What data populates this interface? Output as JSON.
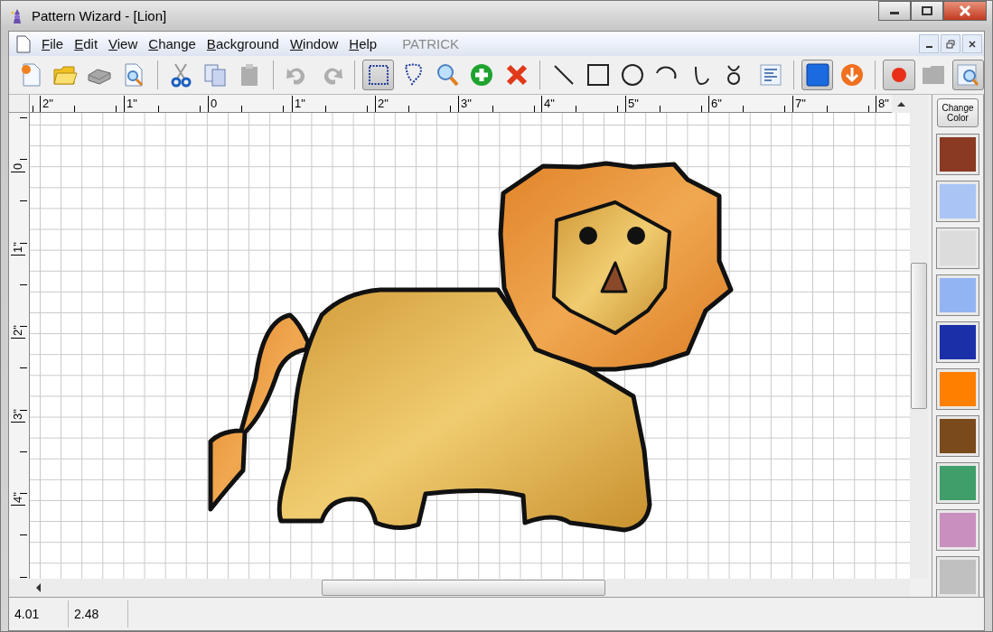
{
  "window": {
    "title": "Pattern Wizard - [Lion]"
  },
  "menu": {
    "items": [
      "File",
      "Edit",
      "View",
      "Change",
      "Background",
      "Window",
      "Help"
    ],
    "user": "PATRICK"
  },
  "toolbar": [
    [
      {
        "kind": "new",
        "pressed": false,
        "disabled": false
      },
      {
        "kind": "open",
        "pressed": false,
        "disabled": false
      },
      {
        "kind": "scanner",
        "pressed": false,
        "disabled": false
      },
      {
        "kind": "preview",
        "pressed": false,
        "disabled": false
      }
    ],
    [
      {
        "kind": "cut",
        "pressed": false,
        "disabled": false
      },
      {
        "kind": "copy",
        "pressed": false,
        "disabled": false
      },
      {
        "kind": "paste",
        "pressed": false,
        "disabled": true
      }
    ],
    [
      {
        "kind": "undo",
        "pressed": false,
        "disabled": true
      },
      {
        "kind": "redo",
        "pressed": false,
        "disabled": true
      }
    ],
    [
      {
        "kind": "select",
        "pressed": true,
        "disabled": false
      },
      {
        "kind": "lasso",
        "pressed": false,
        "disabled": false
      },
      {
        "kind": "zoom",
        "pressed": false,
        "disabled": false
      },
      {
        "kind": "add",
        "pressed": false,
        "disabled": false
      },
      {
        "kind": "delete",
        "pressed": false,
        "disabled": false
      }
    ],
    [
      {
        "kind": "line",
        "pressed": false,
        "disabled": false
      },
      {
        "kind": "rect",
        "pressed": false,
        "disabled": false
      },
      {
        "kind": "circle",
        "pressed": false,
        "disabled": false
      },
      {
        "kind": "arc",
        "pressed": false,
        "disabled": false
      },
      {
        "kind": "curve",
        "pressed": false,
        "disabled": false
      },
      {
        "kind": "loop",
        "pressed": false,
        "disabled": false
      },
      {
        "kind": "text",
        "pressed": false,
        "disabled": false
      }
    ],
    [
      {
        "kind": "fill",
        "pressed": true,
        "disabled": false
      },
      {
        "kind": "download",
        "pressed": false,
        "disabled": false
      }
    ],
    [
      {
        "kind": "record",
        "pressed": true,
        "disabled": false
      },
      {
        "kind": "panel",
        "pressed": false,
        "disabled": true
      },
      {
        "kind": "inspect",
        "pressed": true,
        "disabled": false
      }
    ]
  ],
  "ruler_h": [
    "2\"",
    "1\"",
    "0",
    "1\"",
    "2\"",
    "3\"",
    "4\"",
    "5\"",
    "6\"",
    "7\"",
    "8\""
  ],
  "ruler_v": [
    "0",
    "1\"",
    "2\"",
    "3\"",
    "4\""
  ],
  "palette": {
    "button": "Change Color",
    "swatches": [
      {
        "color": "#8a3a22"
      },
      {
        "color": "#a9c4f5"
      },
      {
        "color": "#dcdcdc"
      },
      {
        "color": "#93b4f2"
      },
      {
        "color": "#1a2fa8"
      },
      {
        "color": "#ff8000"
      },
      {
        "color": "#7a4a1c"
      },
      {
        "color": "#3f9e6a"
      },
      {
        "color": "#c98fbf"
      },
      {
        "color": "#c0c0c0"
      }
    ]
  },
  "status_bar": [
    "4.01",
    "2.48"
  ]
}
